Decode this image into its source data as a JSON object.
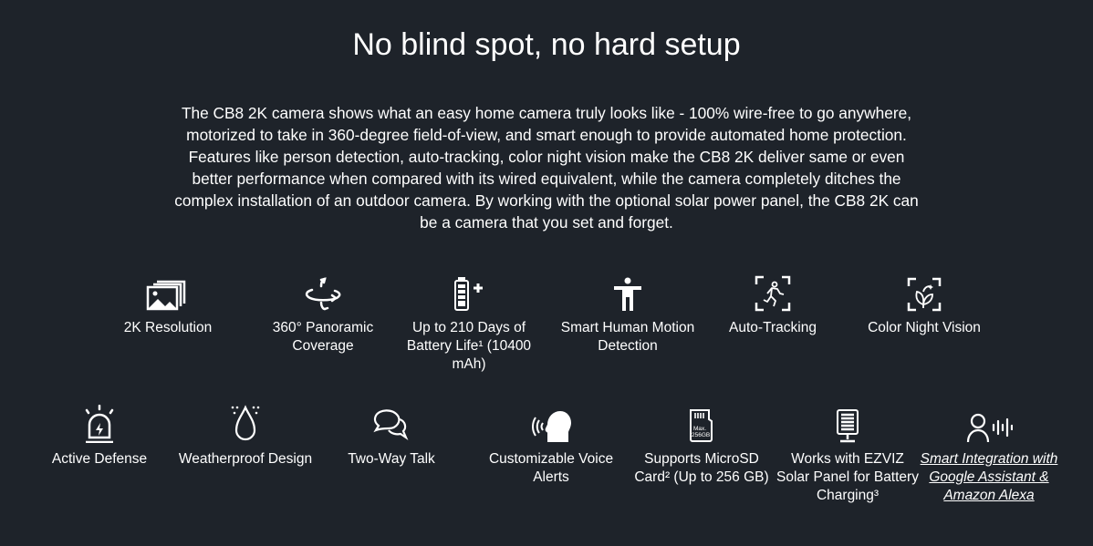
{
  "header": {
    "title": "No blind spot, no hard setup"
  },
  "description": "The CB8 2K camera shows what an easy home camera truly looks like - 100% wire-free to go anywhere, motorized to take in 360-degree field-of-view, and smart enough to provide automated home protection. Features like person detection, auto-tracking, color night vision make the CB8 2K deliver same or even better performance when compared with its wired equivalent, while the camera completely ditches the complex installation of an outdoor camera. By working with the optional solar power panel, the CB8 2K can be a camera that you set and forget.",
  "features_row1": [
    {
      "icon": "images-icon",
      "label": "2K Resolution"
    },
    {
      "icon": "rotate-360-icon",
      "label": "360° Panoramic Coverage"
    },
    {
      "icon": "battery-icon",
      "label": "Up to 210 Days of Battery Life¹ (10400 mAh)"
    },
    {
      "icon": "human-icon",
      "label": "Smart Human Motion Detection"
    },
    {
      "icon": "tracking-icon",
      "label": "Auto-Tracking"
    },
    {
      "icon": "night-vision-icon",
      "label": "Color Night Vision"
    }
  ],
  "features_row2": [
    {
      "icon": "siren-icon",
      "label": "Active Defense"
    },
    {
      "icon": "water-drop-icon",
      "label": "Weatherproof Design"
    },
    {
      "icon": "chat-icon",
      "label": "Two-Way Talk"
    },
    {
      "icon": "voice-alert-icon",
      "label": "Customizable Voice Alerts"
    },
    {
      "icon": "microsd-icon",
      "label": "Supports MicroSD Card² (Up to 256 GB)",
      "card_text": [
        "Max.",
        "256GB"
      ]
    },
    {
      "icon": "solar-panel-icon",
      "label": "Works with EZVIZ Solar Panel for Battery Charging³"
    },
    {
      "icon": "voice-assistant-icon",
      "label": "Smart Integration with Google Assistant & Amazon Alexa",
      "link": true
    }
  ]
}
